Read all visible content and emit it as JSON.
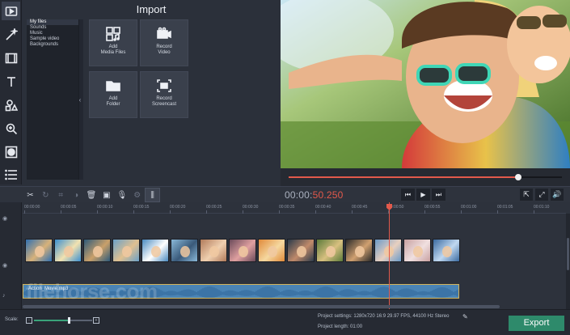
{
  "import_panel": {
    "title": "Import",
    "tree": [
      "My files",
      "Sounds",
      "Music",
      "Sample video",
      "Backgrounds"
    ],
    "tiles": [
      {
        "label_line1": "Add",
        "label_line2": "Media Files",
        "icon": "add-media-icon"
      },
      {
        "label_line1": "Record",
        "label_line2": "Video",
        "icon": "camera-icon"
      },
      {
        "label_line1": "Add",
        "label_line2": "Folder",
        "icon": "folder-icon"
      },
      {
        "label_line1": "Record",
        "label_line2": "Screencast",
        "icon": "screencast-icon"
      }
    ]
  },
  "left_tools": [
    "import-icon",
    "magic-wand-icon",
    "filters-icon",
    "titles-icon",
    "stickers-icon",
    "zoom-icon",
    "overlay-icon",
    "more-icon"
  ],
  "player": {
    "timecode_prefix": "00:00:",
    "timecode_time": "50.250",
    "progress": 0.84
  },
  "timeline": {
    "ticks": [
      "00:00:00",
      "00:00:05",
      "00:00:10",
      "00:00:15",
      "00:00:20",
      "00:00:25",
      "00:00:30",
      "00:00:35",
      "00:00:40",
      "00:00:45",
      "00:00:50",
      "00:00:55",
      "00:01:00",
      "00:01:05",
      "00:01:10"
    ],
    "audio_clip_name": "Action_Movie.mp3"
  },
  "bottom": {
    "scale_label": "Scale:",
    "project_settings": "Project settings:   1280x720 16:9 29.97 FPS, 44100 Hz Stereo",
    "project_length": "Project length:       01:00",
    "export_label": "Export"
  },
  "watermark": "filehorse.com",
  "colors": {
    "accent_red": "#e2594b",
    "export_green": "#2e8a6b",
    "audio_blue": "#4a84b5"
  }
}
